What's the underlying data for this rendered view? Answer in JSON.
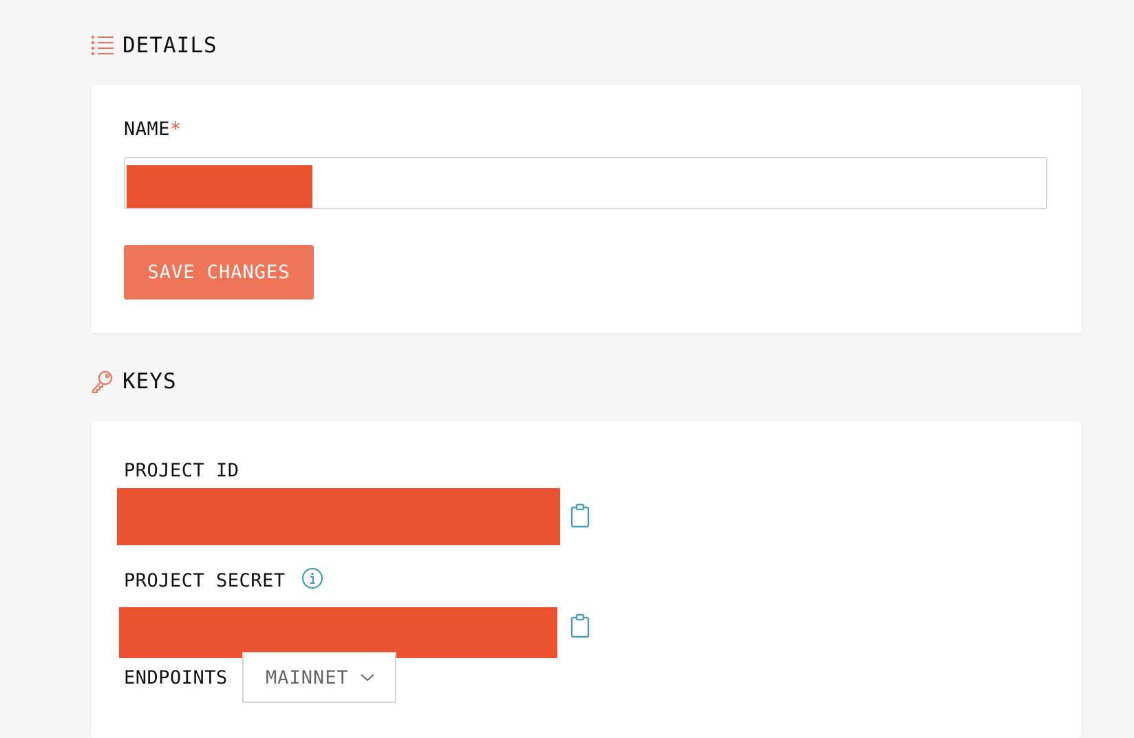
{
  "details": {
    "title": "DETAILS",
    "name_label": "NAME",
    "required_mark": "*",
    "save_label": "SAVE CHANGES"
  },
  "keys": {
    "title": "KEYS",
    "project_id_label": "PROJECT ID",
    "project_secret_label": "PROJECT SECRET",
    "endpoints_label": "ENDPOINTS",
    "endpoint_selected": "MAINNET"
  },
  "icons": {
    "details": "list-icon",
    "keys": "key-icon",
    "copy": "clipboard-icon",
    "info": "info-icon",
    "dropdown": "chevron-down-icon"
  },
  "colors": {
    "accent": "#ef7558",
    "redaction": "#eb522f",
    "icon_teal": "#4a9bb5"
  }
}
